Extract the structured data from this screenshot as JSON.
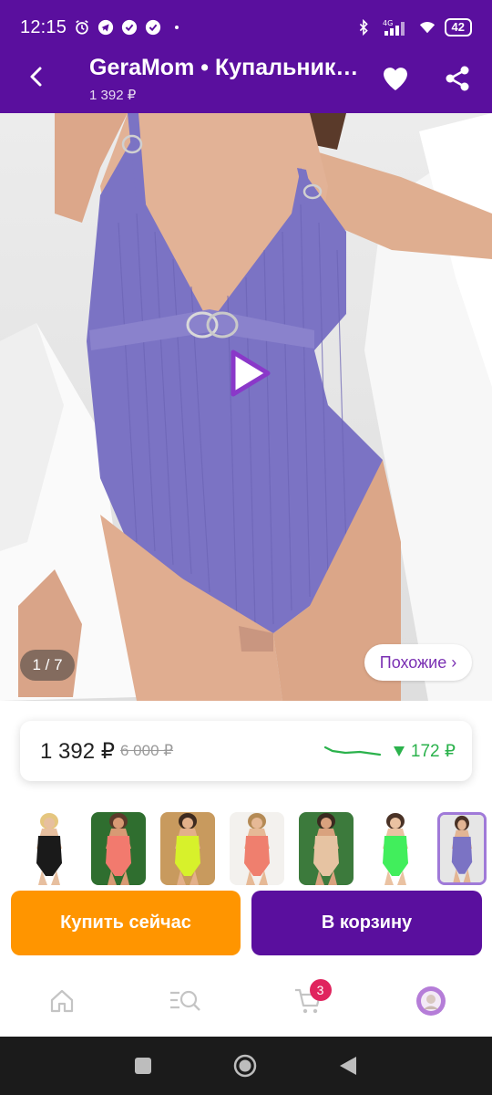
{
  "status_bar": {
    "time": "12:15",
    "battery": "42",
    "network": "4G"
  },
  "app_bar": {
    "title": "GeraMom • Купальник слитный",
    "subtitle": "1 392 ₽"
  },
  "gallery": {
    "counter": "1 / 7",
    "similar_label": "Похожие ›"
  },
  "price": {
    "current": "1 392 ₽",
    "old": "6 000 ₽",
    "change": "172 ₽",
    "change_color": "#2bb24c"
  },
  "thumbnails": [
    {
      "bg": "#ffffff",
      "suit": "#1a1a1a",
      "skin": "#e7bf9f",
      "hair": "#e5c67f"
    },
    {
      "bg": "#2f6e2f",
      "suit": "#f27a6e",
      "skin": "#d89a74",
      "hair": "#5b3a2a"
    },
    {
      "bg": "#c89a5e",
      "suit": "#d7f12b",
      "skin": "#e3b08a",
      "hair": "#3d2a1f"
    },
    {
      "bg": "#f3f1ee",
      "suit": "#ef7f6e",
      "skin": "#e6b996",
      "hair": "#b48a55"
    },
    {
      "bg": "#3c7a3c",
      "suit": "#e6c3a2",
      "skin": "#d9a27e",
      "hair": "#3a2a20"
    },
    {
      "bg": "#ffffff",
      "suit": "#41ee5c",
      "skin": "#eac2a2",
      "hair": "#4a3226"
    },
    {
      "bg": "#e6e6e6",
      "suit": "#7b73c4",
      "skin": "#e3b594",
      "hair": "#4a3226"
    }
  ],
  "actions": {
    "buy_now": "Купить сейчас",
    "to_cart": "В корзину"
  },
  "bottom_nav": {
    "cart_count": "3"
  },
  "colors": {
    "brand": "#5a0f9e",
    "buy_now": "#ff9500",
    "badge": "#e0245e",
    "suit": "#7b73c4"
  }
}
